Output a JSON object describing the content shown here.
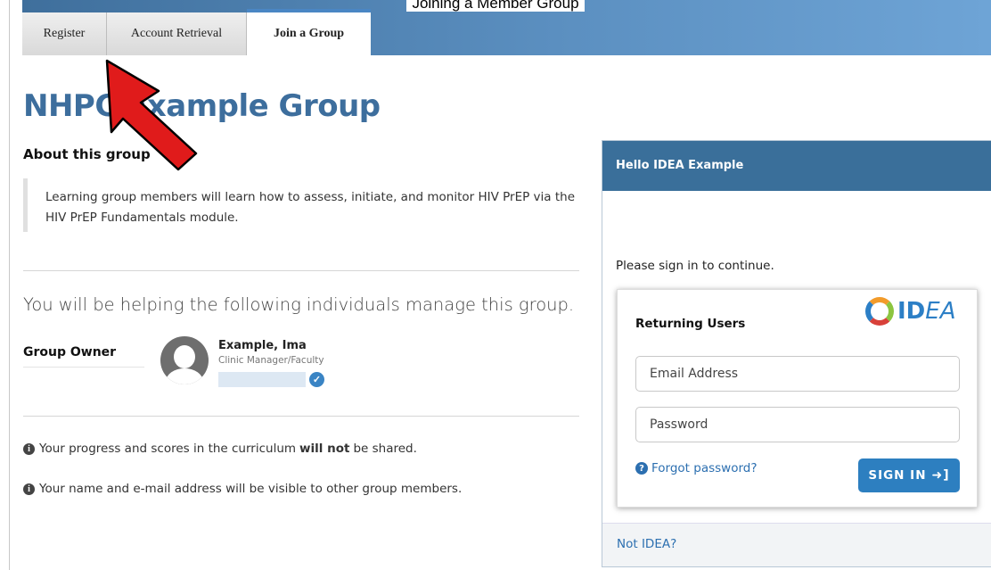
{
  "banner": {
    "title": "Joining a Member Group"
  },
  "tabs": [
    {
      "label": "Register"
    },
    {
      "label": "Account Retrieval"
    },
    {
      "label": "Join a Group"
    }
  ],
  "group": {
    "title": "NHPC Example Group",
    "about_heading": "About this group",
    "about_text": "Learning group members will learn how to assess, initiate, and monitor HIV PrEP via the HIV PrEP Fundamentals module."
  },
  "managers": {
    "intro": "You will be helping the following individuals manage this group.",
    "owner_label": "Group Owner",
    "owner_name": "Example, Ima",
    "owner_role": "Clinic Manager/Faculty"
  },
  "notices": [
    {
      "before": "Your progress and scores in the curriculum",
      "bold": "will not",
      "after": "be shared."
    },
    {
      "text": "Your name and e-mail address will be visible to other group members."
    }
  ],
  "signin": {
    "header": "Hello IDEA Example",
    "prompt": "Please sign in to continue.",
    "returning_label": "Returning Users",
    "logo_text_bold": "ID",
    "logo_text_italic": "EA",
    "email_placeholder": "Email Address",
    "password_placeholder": "Password",
    "forgot_label": "Forgot password?",
    "button_label": "SIGN IN",
    "footer_link": "Not IDEA?"
  },
  "colors": {
    "banner": "#3f6f9c",
    "title": "#3d6e9d",
    "panel_header": "#3a6f9a",
    "button": "#2d7fc0",
    "annotation_arrow": "#e01b1b"
  },
  "icons": [
    "user-avatar-icon",
    "verified-check-icon",
    "info-icon",
    "question-icon",
    "sign-in-icon",
    "idea-logo",
    "annotation-arrow"
  ]
}
